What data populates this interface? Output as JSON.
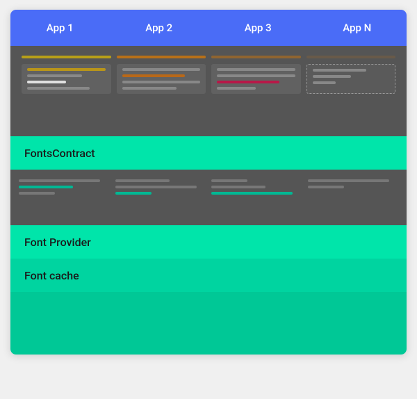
{
  "tabs": [
    {
      "id": "app1",
      "label": "App 1"
    },
    {
      "id": "app2",
      "label": "App 2"
    },
    {
      "id": "app3",
      "label": "App 3"
    },
    {
      "id": "appn",
      "label": "App N"
    }
  ],
  "sections": {
    "fonts_contract": "FontsContract",
    "font_provider": "Font Provider",
    "font_cache": "Font cache"
  },
  "colors": {
    "tab_bg": "#5b6af5",
    "apps_dark": "#575757",
    "teal_bright": "#00e5b0",
    "teal_mid": "#00d4a0",
    "teal_dark": "#00c896",
    "text_dark": "#111111"
  }
}
